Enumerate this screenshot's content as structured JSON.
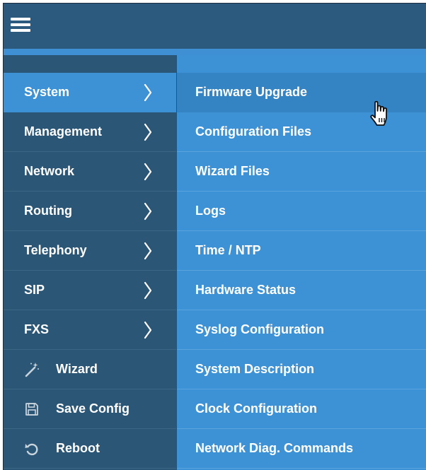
{
  "header": {
    "menu_icon": "hamburger-menu-icon"
  },
  "left_menu": {
    "items": [
      {
        "label": "System",
        "icon": "chevron-right-icon",
        "active": true
      },
      {
        "label": "Management",
        "icon": "chevron-right-icon"
      },
      {
        "label": "Network",
        "icon": "chevron-right-icon"
      },
      {
        "label": "Routing",
        "icon": "chevron-right-icon"
      },
      {
        "label": "Telephony",
        "icon": "chevron-right-icon"
      },
      {
        "label": "SIP",
        "icon": "chevron-right-icon"
      },
      {
        "label": "FXS",
        "icon": "chevron-right-icon"
      },
      {
        "label": "Wizard",
        "icon": "magic-wand-icon"
      },
      {
        "label": "Save Config",
        "icon": "floppy-disk-icon"
      },
      {
        "label": "Reboot",
        "icon": "reboot-icon"
      }
    ]
  },
  "submenu": {
    "items": [
      {
        "label": "Firmware Upgrade",
        "hovered": true
      },
      {
        "label": "Configuration Files"
      },
      {
        "label": "Wizard Files"
      },
      {
        "label": "Logs"
      },
      {
        "label": "Time / NTP"
      },
      {
        "label": "Hardware Status"
      },
      {
        "label": "Syslog Configuration"
      },
      {
        "label": "System Description"
      },
      {
        "label": "Clock Configuration"
      },
      {
        "label": "Network Diag. Commands"
      }
    ]
  },
  "cursor": {
    "icon": "hand-pointer-cursor-icon"
  },
  "colors": {
    "header": "#2b5a7e",
    "accent": "#3f8fd4",
    "left_panel": "#2b5676",
    "active_item": "#3d92d6",
    "submenu_bg": "#3d92d6",
    "submenu_hover": "#3483c2",
    "text": "#ffffff"
  }
}
